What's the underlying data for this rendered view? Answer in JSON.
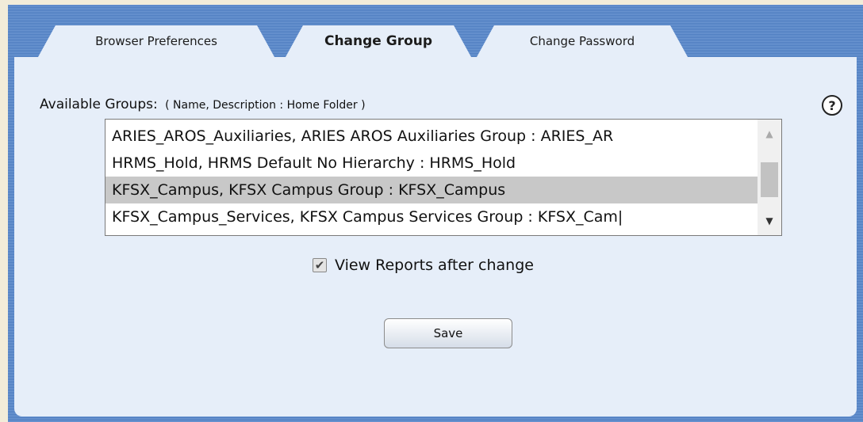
{
  "tabs": [
    {
      "label": "Browser Preferences",
      "active": false
    },
    {
      "label": "Change Group",
      "active": true
    },
    {
      "label": "Change Password",
      "active": false
    }
  ],
  "groups": {
    "label": "Available Groups:",
    "hint": "( Name, Description : Home Folder )",
    "items": [
      {
        "text": "ARIES_AROS_Auxiliaries, ARIES AROS Auxiliaries Group : ARIES_AR",
        "selected": false
      },
      {
        "text": "HRMS_Hold, HRMS Default No Hierarchy : HRMS_Hold",
        "selected": false
      },
      {
        "text": "KFSX_Campus, KFSX Campus Group : KFSX_Campus",
        "selected": true
      },
      {
        "text": "KFSX_Campus_Services, KFSX Campus Services Group : KFSX_Cam|",
        "selected": false
      }
    ]
  },
  "help": {
    "icon": "question-circle-icon",
    "glyph": "?"
  },
  "view_reports": {
    "label": "View Reports after change",
    "checked": true
  },
  "save_label": "Save",
  "colors": {
    "page_background": "#f2ecd9",
    "frame_blue": "#4f7fc2",
    "panel_background": "#e6eef9",
    "selected_row": "#c8c8c8"
  }
}
